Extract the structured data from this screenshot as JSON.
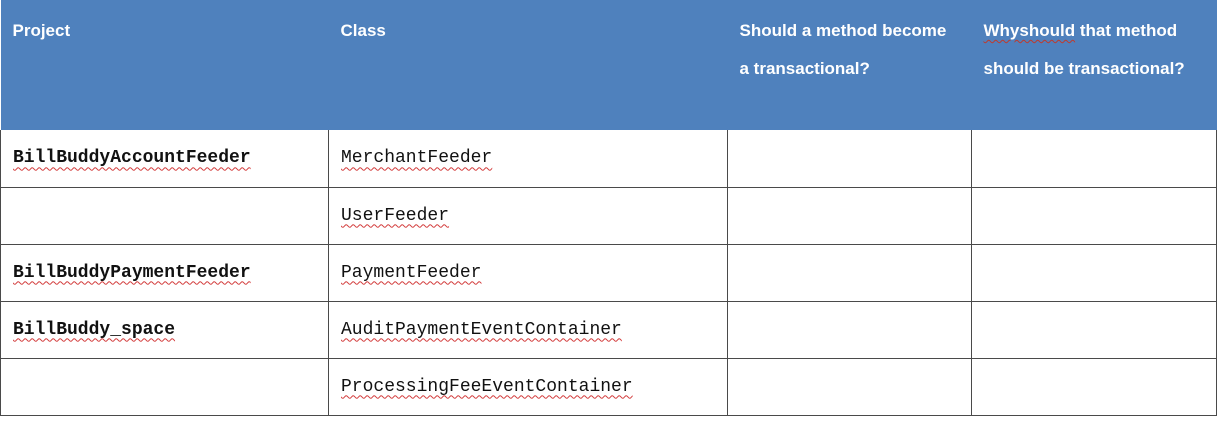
{
  "table": {
    "headers": {
      "project": "Project",
      "class": "Class",
      "should_transactional": "Should a method become a transactional?",
      "why_prefix": "Whyshould",
      "why_rest": " that method should be transactional?"
    },
    "rows": [
      {
        "project": "BillBuddyAccountFeeder",
        "class": "MerchantFeeder",
        "should": "",
        "why": ""
      },
      {
        "project": "",
        "class": "UserFeeder",
        "should": "",
        "why": ""
      },
      {
        "project": "BillBuddyPaymentFeeder",
        "class": "PaymentFeeder",
        "should": "",
        "why": ""
      },
      {
        "project": "BillBuddy_space",
        "class": "AuditPaymentEventContainer",
        "should": "",
        "why": ""
      },
      {
        "project": "",
        "class": "ProcessingFeeEventContainer",
        "should": "",
        "why": ""
      }
    ]
  }
}
